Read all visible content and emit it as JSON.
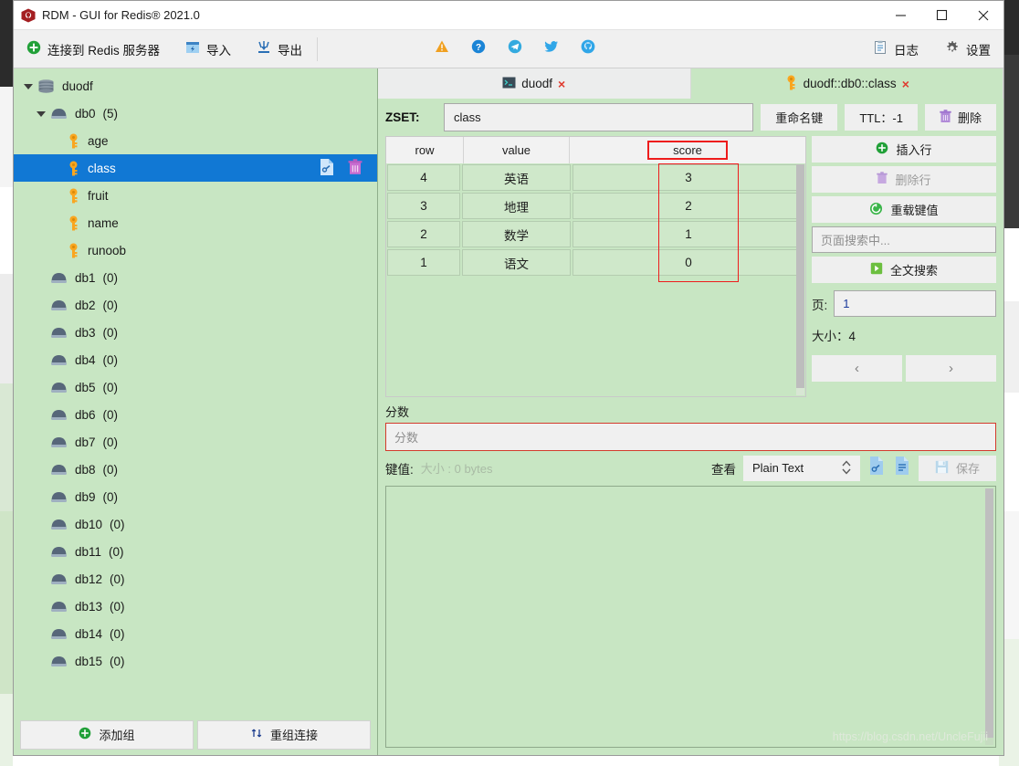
{
  "window": {
    "title": "RDM - GUI for Redis® 2021.0",
    "app_icon": "redis-logo-icon",
    "minimize": "minimize-icon",
    "maximize": "maximize-icon",
    "close": "close-icon"
  },
  "toolbar": {
    "connect_label": "连接到 Redis 服务器",
    "import_label": "导入",
    "export_label": "导出",
    "log_label": "日志",
    "settings_label": "设置",
    "icons": [
      "warning-icon",
      "help-icon",
      "telegram-icon",
      "twitter-icon",
      "github-icon"
    ]
  },
  "sidebar": {
    "tree": [
      {
        "label": "duodf",
        "count": "",
        "level": 0,
        "icon": "server-icon",
        "expanded": true,
        "selected": false
      },
      {
        "label": "db0",
        "count": "(5)",
        "level": 1,
        "icon": "database-icon",
        "expanded": true,
        "selected": false
      },
      {
        "label": "age",
        "count": "",
        "level": 2,
        "icon": "key-icon",
        "expanded": false,
        "selected": false
      },
      {
        "label": "class",
        "count": "",
        "level": 2,
        "icon": "key-icon",
        "expanded": false,
        "selected": true
      },
      {
        "label": "fruit",
        "count": "",
        "level": 2,
        "icon": "key-icon",
        "expanded": false,
        "selected": false
      },
      {
        "label": "name",
        "count": "",
        "level": 2,
        "icon": "key-icon",
        "expanded": false,
        "selected": false
      },
      {
        "label": "runoob",
        "count": "",
        "level": 2,
        "icon": "key-icon",
        "expanded": false,
        "selected": false
      },
      {
        "label": "db1",
        "count": "(0)",
        "level": 1,
        "icon": "database-icon",
        "expanded": false,
        "selected": false
      },
      {
        "label": "db2",
        "count": "(0)",
        "level": 1,
        "icon": "database-icon",
        "expanded": false,
        "selected": false
      },
      {
        "label": "db3",
        "count": "(0)",
        "level": 1,
        "icon": "database-icon",
        "expanded": false,
        "selected": false
      },
      {
        "label": "db4",
        "count": "(0)",
        "level": 1,
        "icon": "database-icon",
        "expanded": false,
        "selected": false
      },
      {
        "label": "db5",
        "count": "(0)",
        "level": 1,
        "icon": "database-icon",
        "expanded": false,
        "selected": false
      },
      {
        "label": "db6",
        "count": "(0)",
        "level": 1,
        "icon": "database-icon",
        "expanded": false,
        "selected": false
      },
      {
        "label": "db7",
        "count": "(0)",
        "level": 1,
        "icon": "database-icon",
        "expanded": false,
        "selected": false
      },
      {
        "label": "db8",
        "count": "(0)",
        "level": 1,
        "icon": "database-icon",
        "expanded": false,
        "selected": false
      },
      {
        "label": "db9",
        "count": "(0)",
        "level": 1,
        "icon": "database-icon",
        "expanded": false,
        "selected": false
      },
      {
        "label": "db10",
        "count": "(0)",
        "level": 1,
        "icon": "database-icon",
        "expanded": false,
        "selected": false
      },
      {
        "label": "db11",
        "count": "(0)",
        "level": 1,
        "icon": "database-icon",
        "expanded": false,
        "selected": false
      },
      {
        "label": "db12",
        "count": "(0)",
        "level": 1,
        "icon": "database-icon",
        "expanded": false,
        "selected": false
      },
      {
        "label": "db13",
        "count": "(0)",
        "level": 1,
        "icon": "database-icon",
        "expanded": false,
        "selected": false
      },
      {
        "label": "db14",
        "count": "(0)",
        "level": 1,
        "icon": "database-icon",
        "expanded": false,
        "selected": false
      },
      {
        "label": "db15",
        "count": "(0)",
        "level": 1,
        "icon": "database-icon",
        "expanded": false,
        "selected": false
      }
    ],
    "row_actions": [
      "copy-key-icon",
      "delete-key-icon"
    ],
    "add_group_label": "添加组",
    "reconnect_label": "重组连接"
  },
  "tabs": [
    {
      "label": "duodf",
      "icon": "console-icon",
      "active": false,
      "close": "×"
    },
    {
      "label": "duodf::db0::class",
      "icon": "key-icon",
      "active": true,
      "close": "×"
    }
  ],
  "key_header": {
    "type_label": "ZSET:",
    "key_name": "class",
    "rename_label": "重命名键",
    "ttl_label": "TTL：-1",
    "delete_label": "删除"
  },
  "table": {
    "columns": [
      "row",
      "value",
      "score"
    ],
    "highlighted_column": "score",
    "rows": [
      {
        "row": "1",
        "value": "语文",
        "score": "0"
      },
      {
        "row": "2",
        "value": "数学",
        "score": "1"
      },
      {
        "row": "3",
        "value": "地理",
        "score": "2"
      },
      {
        "row": "4",
        "value": "英语",
        "score": "3"
      }
    ]
  },
  "actions": {
    "insert_row": "插入行",
    "delete_row": "删除行",
    "reload_value": "重载键值",
    "search_placeholder": "页面搜索中...",
    "full_search": "全文搜索",
    "page_label": "页:",
    "page_value": "1",
    "size_label": "大小：4",
    "prev": "‹",
    "next": "›"
  },
  "score_section": {
    "label": "分数",
    "placeholder": "分数"
  },
  "value_section": {
    "label": "键值:",
    "size_text": "大小 : 0 bytes",
    "view_label": "查看",
    "view_mode": "Plain Text",
    "icons": [
      "link-format-icon",
      "text-format-icon"
    ],
    "save_label": "保存",
    "content": ""
  },
  "watermark": "https://blog.csdn.net/UncleFujii",
  "colors": {
    "accent_green": "#c8e6c3",
    "row_green": "#cfe8ca",
    "selection_blue": "#1178d4",
    "highlight_red": "#ee1c1c",
    "key_orange": "#f9a620"
  }
}
